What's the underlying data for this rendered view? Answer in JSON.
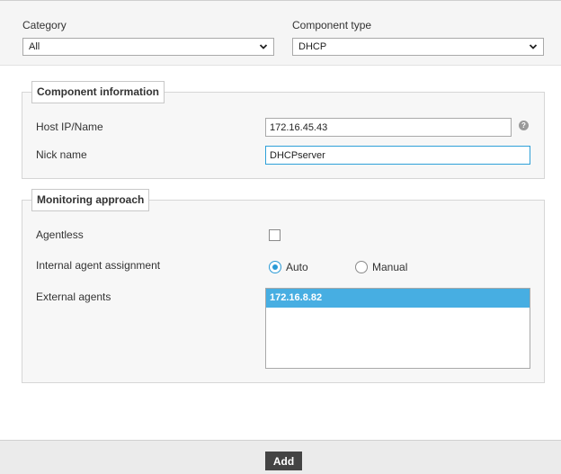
{
  "header": {
    "category": {
      "label": "Category",
      "selected": "All"
    },
    "component_type": {
      "label": "Component type",
      "selected": "DHCP"
    }
  },
  "component_info": {
    "legend": "Component information",
    "host_label": "Host IP/Name",
    "host_value": "172.16.45.43",
    "help_glyph": "?",
    "nick_label": "Nick name",
    "nick_value": "DHCPserver"
  },
  "monitoring": {
    "legend": "Monitoring approach",
    "agentless_label": "Agentless",
    "agentless_checked": false,
    "assignment_label": "Internal agent assignment",
    "option_auto": "Auto",
    "option_manual": "Manual",
    "selected_option": "Auto",
    "external_label": "External agents",
    "external_agents": [
      "172.16.8.82"
    ]
  },
  "footer": {
    "add_label": "Add"
  },
  "colors": {
    "accent": "#2a9ad6",
    "selected_row": "#47aee2",
    "button": "#444444"
  },
  "icons": {
    "dropdown": "chevron-down-icon",
    "help": "help-icon"
  }
}
